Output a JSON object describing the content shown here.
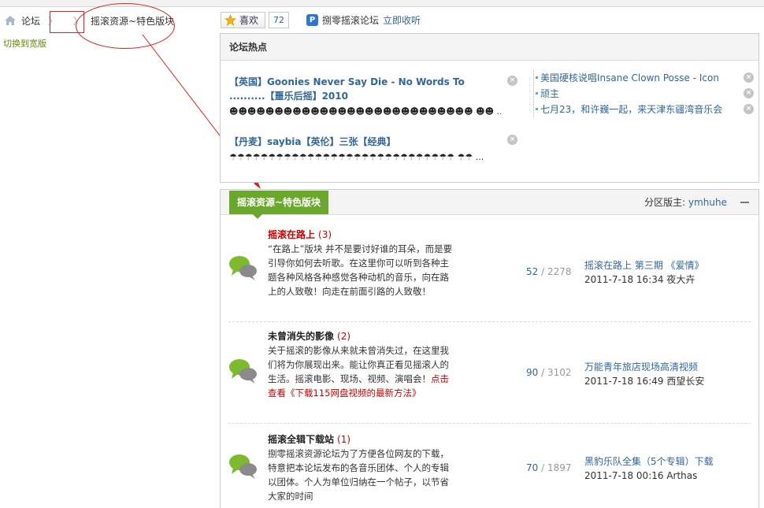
{
  "breadcrumb": {
    "home_icon": "home-icon",
    "forum_label": "论坛",
    "separator": "〉",
    "current": "摇滚资源~特色版块"
  },
  "switch_label": "切换到宽版",
  "toolbar": {
    "like_label": "喜欢",
    "like_count": "72",
    "radio_name": "捌零摇滚论坛",
    "radio_listen": "立即收听"
  },
  "hot": {
    "title": "论坛热点",
    "left_items": [
      {
        "title": "【英国】Goonies Never Say Die - No Words To ..........【噩乐后摇】2010",
        "desc": "☻☻☻☻☻☻☻☻☻☻☻☻☻☻☻☻☻☻☻☻☻☻☻☻☻☻☻ ☻☻ ..."
      },
      {
        "title": "【丹麦】saybia【英伦】三张【经典】",
        "desc": "☂☂☂☂☂☂☂☂☂☂☂☂☂☂☂☂☂☂☂☂☂☂☂☂☂☂☂☂☂ ☂☂ ..."
      }
    ],
    "right_items": [
      "美国硬核说唱Insane Clown Posse - Icon",
      "顽主",
      "七月23，和许巍一起，来天津东疆湾音乐会"
    ]
  },
  "forum": {
    "tab_label": "摇滚资源~特色版块",
    "moderator_label": "分区版主:",
    "moderator_name": "ymhuhe",
    "rows": [
      {
        "name": "摇滚在路上",
        "count": "(3)",
        "desc": "“在路上”版块 并不是要讨好谁的耳朵，而是要引导你如何去听歌。在这里你可以听到各种主题各种风格各种感觉各种动机的音乐，向在路上的人致敬！向走在前面引路的人致敬！",
        "highlight": "",
        "threads": "52",
        "posts": "2278",
        "last_title": "摇滚在路上 第三期 《爱情》",
        "last_meta": "2011-7-18 16:34 夜大卉"
      },
      {
        "name": "未曾消失的影像",
        "count": "(2)",
        "desc": "关于摇滚的影像从来就未曾消失过，在这里我们将为你展现出来。能让你真正看见摇滚人的生活。摇滚电影、现场、视频、演唱会！",
        "highlight": "点击查看《下载115网盘视频的最新方法》",
        "threads": "90",
        "posts": "3102",
        "last_title": "万能青年旅店现场高清视频",
        "last_meta": "2011-7-18 16:49 西望长安"
      },
      {
        "name": "摇滚全辑下载站",
        "count": "(1)",
        "desc": "捌零摇滚资源论坛为了方便各位网友的下载，特意把本论坛发布的各音乐团体、个人的专辑以团体。个人为单位归纳在一个帖子，以节省大家的时间",
        "highlight": "",
        "threads": "70",
        "posts": "1897",
        "last_title": "黑豹乐队全集（5个专辑）下载",
        "last_meta": "2011-7-18 00:16 Arthas"
      }
    ]
  },
  "colors": {
    "accent_green": "#6aa82b",
    "link_blue": "#336699",
    "annotation_red": "#dd2222"
  }
}
